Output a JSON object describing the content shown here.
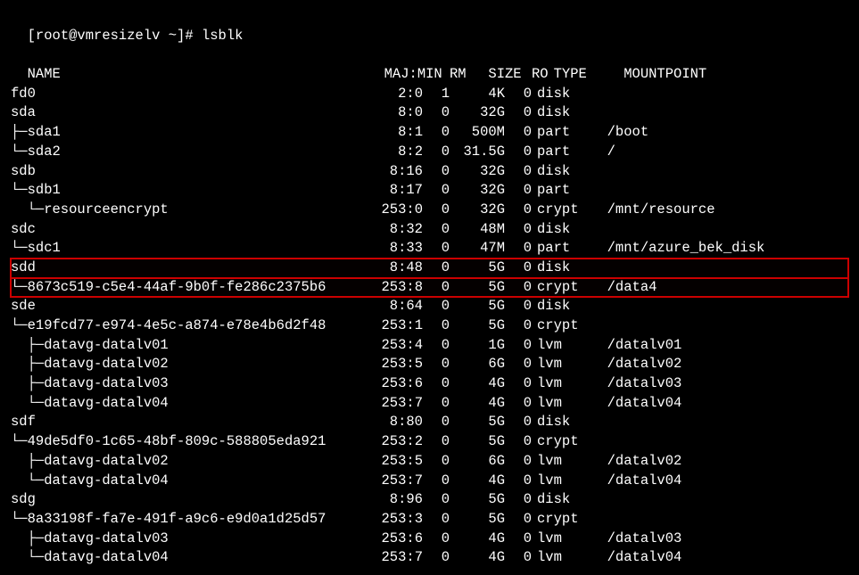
{
  "prompt": "[root@vmresizelv ~]# ",
  "command": "lsblk",
  "columns": {
    "name": "NAME",
    "majmin": "MAJ:MIN",
    "rm": "RM",
    "size": "SIZE",
    "ro": "RO",
    "type": "TYPE",
    "mount": "MOUNTPOINT"
  },
  "rows": [
    {
      "tree": "",
      "name": "fd0",
      "majmin": "2:0",
      "rm": "1",
      "size": "4K",
      "ro": "0",
      "type": "disk",
      "mount": ""
    },
    {
      "tree": "",
      "name": "sda",
      "majmin": "8:0",
      "rm": "0",
      "size": "32G",
      "ro": "0",
      "type": "disk",
      "mount": ""
    },
    {
      "tree": "├─",
      "name": "sda1",
      "majmin": "8:1",
      "rm": "0",
      "size": "500M",
      "ro": "0",
      "type": "part",
      "mount": "/boot"
    },
    {
      "tree": "└─",
      "name": "sda2",
      "majmin": "8:2",
      "rm": "0",
      "size": "31.5G",
      "ro": "0",
      "type": "part",
      "mount": "/"
    },
    {
      "tree": "",
      "name": "sdb",
      "majmin": "8:16",
      "rm": "0",
      "size": "32G",
      "ro": "0",
      "type": "disk",
      "mount": ""
    },
    {
      "tree": "└─",
      "name": "sdb1",
      "majmin": "8:17",
      "rm": "0",
      "size": "32G",
      "ro": "0",
      "type": "part",
      "mount": ""
    },
    {
      "tree": "  └─",
      "name": "resourceencrypt",
      "majmin": "253:0",
      "rm": "0",
      "size": "32G",
      "ro": "0",
      "type": "crypt",
      "mount": "/mnt/resource"
    },
    {
      "tree": "",
      "name": "sdc",
      "majmin": "8:32",
      "rm": "0",
      "size": "48M",
      "ro": "0",
      "type": "disk",
      "mount": ""
    },
    {
      "tree": "└─",
      "name": "sdc1",
      "majmin": "8:33",
      "rm": "0",
      "size": "47M",
      "ro": "0",
      "type": "part",
      "mount": "/mnt/azure_bek_disk"
    },
    {
      "tree": "",
      "name": "sdd",
      "majmin": "8:48",
      "rm": "0",
      "size": "5G",
      "ro": "0",
      "type": "disk",
      "mount": "",
      "highlight": true
    },
    {
      "tree": "└─",
      "name": "8673c519-c5e4-44af-9b0f-fe286c2375b6",
      "majmin": "253:8",
      "rm": "0",
      "size": "5G",
      "ro": "0",
      "type": "crypt",
      "mount": "/data4",
      "highlight": true
    },
    {
      "tree": "",
      "name": "sde",
      "majmin": "8:64",
      "rm": "0",
      "size": "5G",
      "ro": "0",
      "type": "disk",
      "mount": ""
    },
    {
      "tree": "└─",
      "name": "e19fcd77-e974-4e5c-a874-e78e4b6d2f48",
      "majmin": "253:1",
      "rm": "0",
      "size": "5G",
      "ro": "0",
      "type": "crypt",
      "mount": ""
    },
    {
      "tree": "  ├─",
      "name": "datavg-datalv01",
      "majmin": "253:4",
      "rm": "0",
      "size": "1G",
      "ro": "0",
      "type": "lvm",
      "mount": "/datalv01"
    },
    {
      "tree": "  ├─",
      "name": "datavg-datalv02",
      "majmin": "253:5",
      "rm": "0",
      "size": "6G",
      "ro": "0",
      "type": "lvm",
      "mount": "/datalv02"
    },
    {
      "tree": "  ├─",
      "name": "datavg-datalv03",
      "majmin": "253:6",
      "rm": "0",
      "size": "4G",
      "ro": "0",
      "type": "lvm",
      "mount": "/datalv03"
    },
    {
      "tree": "  └─",
      "name": "datavg-datalv04",
      "majmin": "253:7",
      "rm": "0",
      "size": "4G",
      "ro": "0",
      "type": "lvm",
      "mount": "/datalv04"
    },
    {
      "tree": "",
      "name": "sdf",
      "majmin": "8:80",
      "rm": "0",
      "size": "5G",
      "ro": "0",
      "type": "disk",
      "mount": ""
    },
    {
      "tree": "└─",
      "name": "49de5df0-1c65-48bf-809c-588805eda921",
      "majmin": "253:2",
      "rm": "0",
      "size": "5G",
      "ro": "0",
      "type": "crypt",
      "mount": ""
    },
    {
      "tree": "  ├─",
      "name": "datavg-datalv02",
      "majmin": "253:5",
      "rm": "0",
      "size": "6G",
      "ro": "0",
      "type": "lvm",
      "mount": "/datalv02"
    },
    {
      "tree": "  └─",
      "name": "datavg-datalv04",
      "majmin": "253:7",
      "rm": "0",
      "size": "4G",
      "ro": "0",
      "type": "lvm",
      "mount": "/datalv04"
    },
    {
      "tree": "",
      "name": "sdg",
      "majmin": "8:96",
      "rm": "0",
      "size": "5G",
      "ro": "0",
      "type": "disk",
      "mount": ""
    },
    {
      "tree": "└─",
      "name": "8a33198f-fa7e-491f-a9c6-e9d0a1d25d57",
      "majmin": "253:3",
      "rm": "0",
      "size": "5G",
      "ro": "0",
      "type": "crypt",
      "mount": ""
    },
    {
      "tree": "  ├─",
      "name": "datavg-datalv03",
      "majmin": "253:6",
      "rm": "0",
      "size": "4G",
      "ro": "0",
      "type": "lvm",
      "mount": "/datalv03"
    },
    {
      "tree": "  └─",
      "name": "datavg-datalv04",
      "majmin": "253:7",
      "rm": "0",
      "size": "4G",
      "ro": "0",
      "type": "lvm",
      "mount": "/datalv04"
    }
  ]
}
